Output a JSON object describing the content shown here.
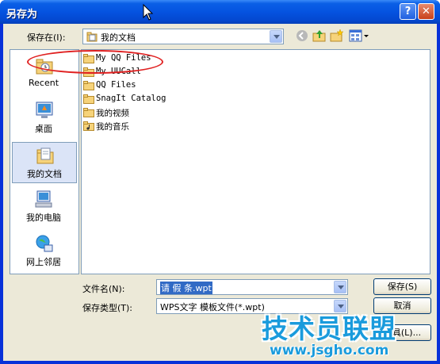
{
  "window": {
    "title": "另存为"
  },
  "toolbar": {
    "save_in_label": "保存在(I):",
    "save_in_value": "我的文档",
    "tools": [
      "back-icon",
      "up-folder-icon",
      "new-folder-icon",
      "view-menu-icon"
    ]
  },
  "places": [
    {
      "label": "Recent",
      "icon": "recent-icon"
    },
    {
      "label": "桌面",
      "icon": "desktop-icon"
    },
    {
      "label": "我的文档",
      "icon": "my-documents-icon",
      "selected": true
    },
    {
      "label": "我的电脑",
      "icon": "my-computer-icon"
    },
    {
      "label": "网上邻居",
      "icon": "network-icon"
    }
  ],
  "files": [
    {
      "name": "My QQ Files",
      "icon": "folder-icon"
    },
    {
      "name": "My UUCall",
      "icon": "folder-icon"
    },
    {
      "name": "QQ Files",
      "icon": "folder-icon"
    },
    {
      "name": "SnagIt Catalog",
      "icon": "folder-icon"
    },
    {
      "name": "我的视频",
      "icon": "folder-icon"
    },
    {
      "name": "我的音乐",
      "icon": "music-folder-icon"
    }
  ],
  "form": {
    "filename_label": "文件名(N):",
    "filename_value": "请 假 条.wpt",
    "filetype_label": "保存类型(T):",
    "filetype_value": "WPS文字 模板文件(*.wpt)"
  },
  "buttons": {
    "save": "保存(S)",
    "cancel": "取消",
    "tools": "工具(L)..."
  },
  "watermark": {
    "text": "技术员联盟",
    "url": "www.jsgho.com"
  },
  "colors": {
    "title_bar": "#0553e0",
    "dialog_bg": "#ece9d8",
    "annotation": "#e02020",
    "watermark": "#1a9bdc"
  }
}
